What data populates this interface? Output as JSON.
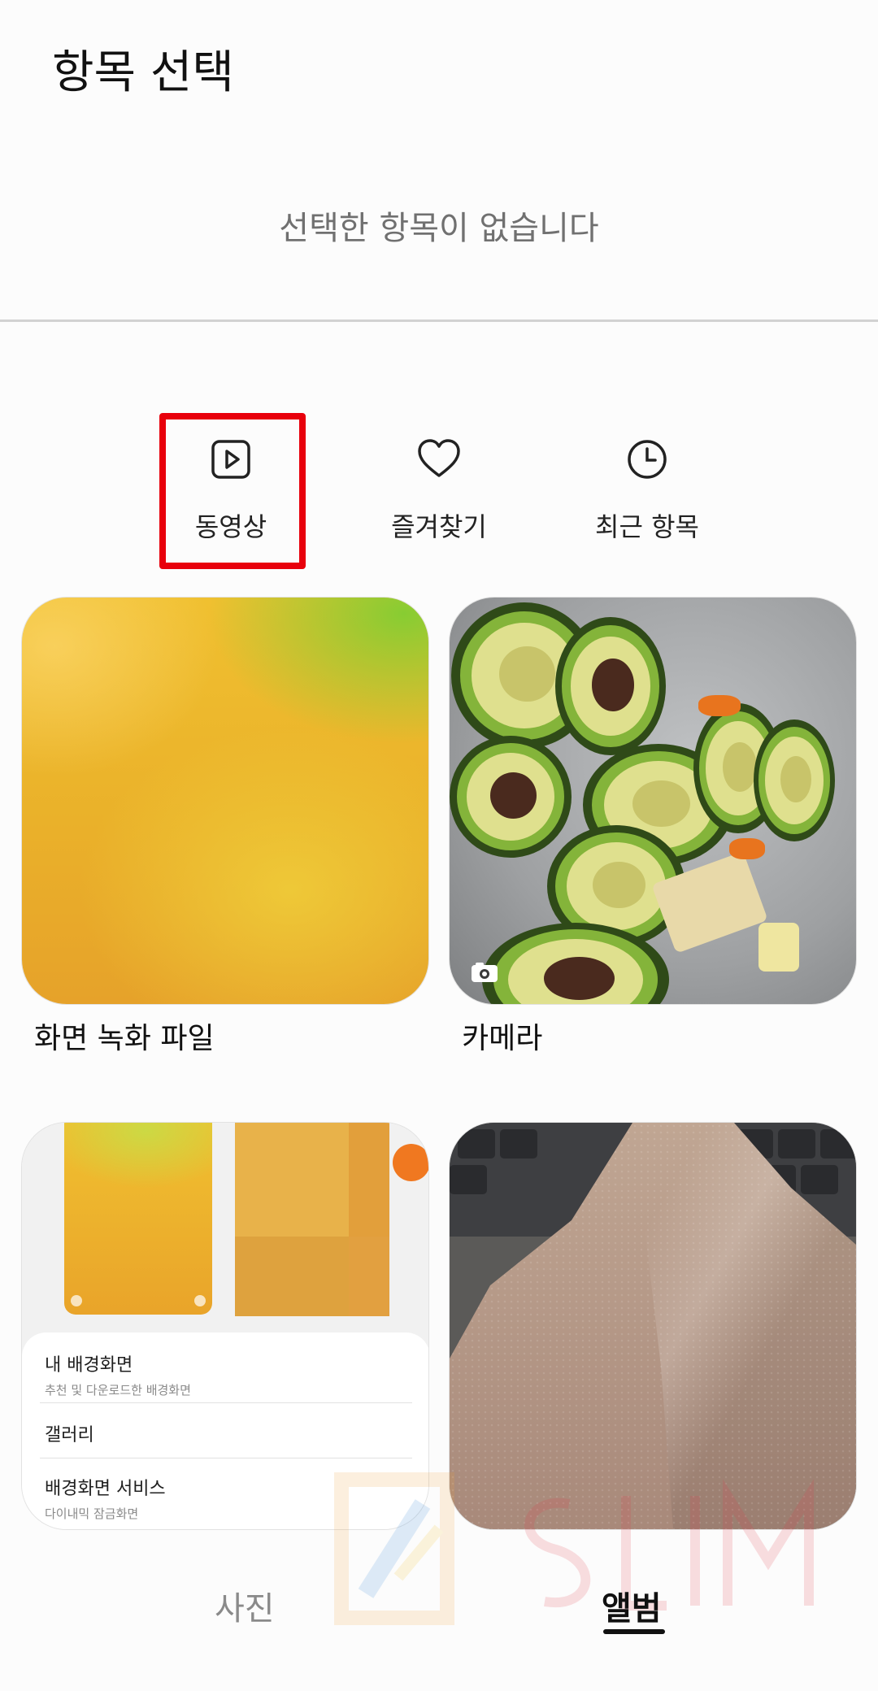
{
  "header": {
    "title": "항목 선택"
  },
  "selection": {
    "empty_message": "선택한 항목이 없습니다"
  },
  "quick_filters": [
    {
      "label": "동영상",
      "icon": "video-play-icon"
    },
    {
      "label": "즐겨찾기",
      "icon": "heart-icon"
    },
    {
      "label": "최근 항목",
      "icon": "clock-icon"
    }
  ],
  "albums": [
    {
      "name": "화면 녹화 파일"
    },
    {
      "name": "카메라",
      "badge_icon": "camera-icon"
    },
    {
      "name": "",
      "thumbnail_menu": [
        {
          "title": "내 배경화면",
          "subtitle": "추천 및 다운로드한 배경화면"
        },
        {
          "title": "갤러리",
          "subtitle": ""
        },
        {
          "title": "배경화면 서비스",
          "subtitle": "다이내믹 잠금화면"
        }
      ]
    },
    {
      "name": ""
    }
  ],
  "bottom_tabs": [
    {
      "label": "사진",
      "selected": false
    },
    {
      "label": "앨범",
      "selected": true
    }
  ],
  "colors": {
    "highlight_box": "#e8000c",
    "divider": "#d2d2d2",
    "muted_text": "#707070"
  }
}
